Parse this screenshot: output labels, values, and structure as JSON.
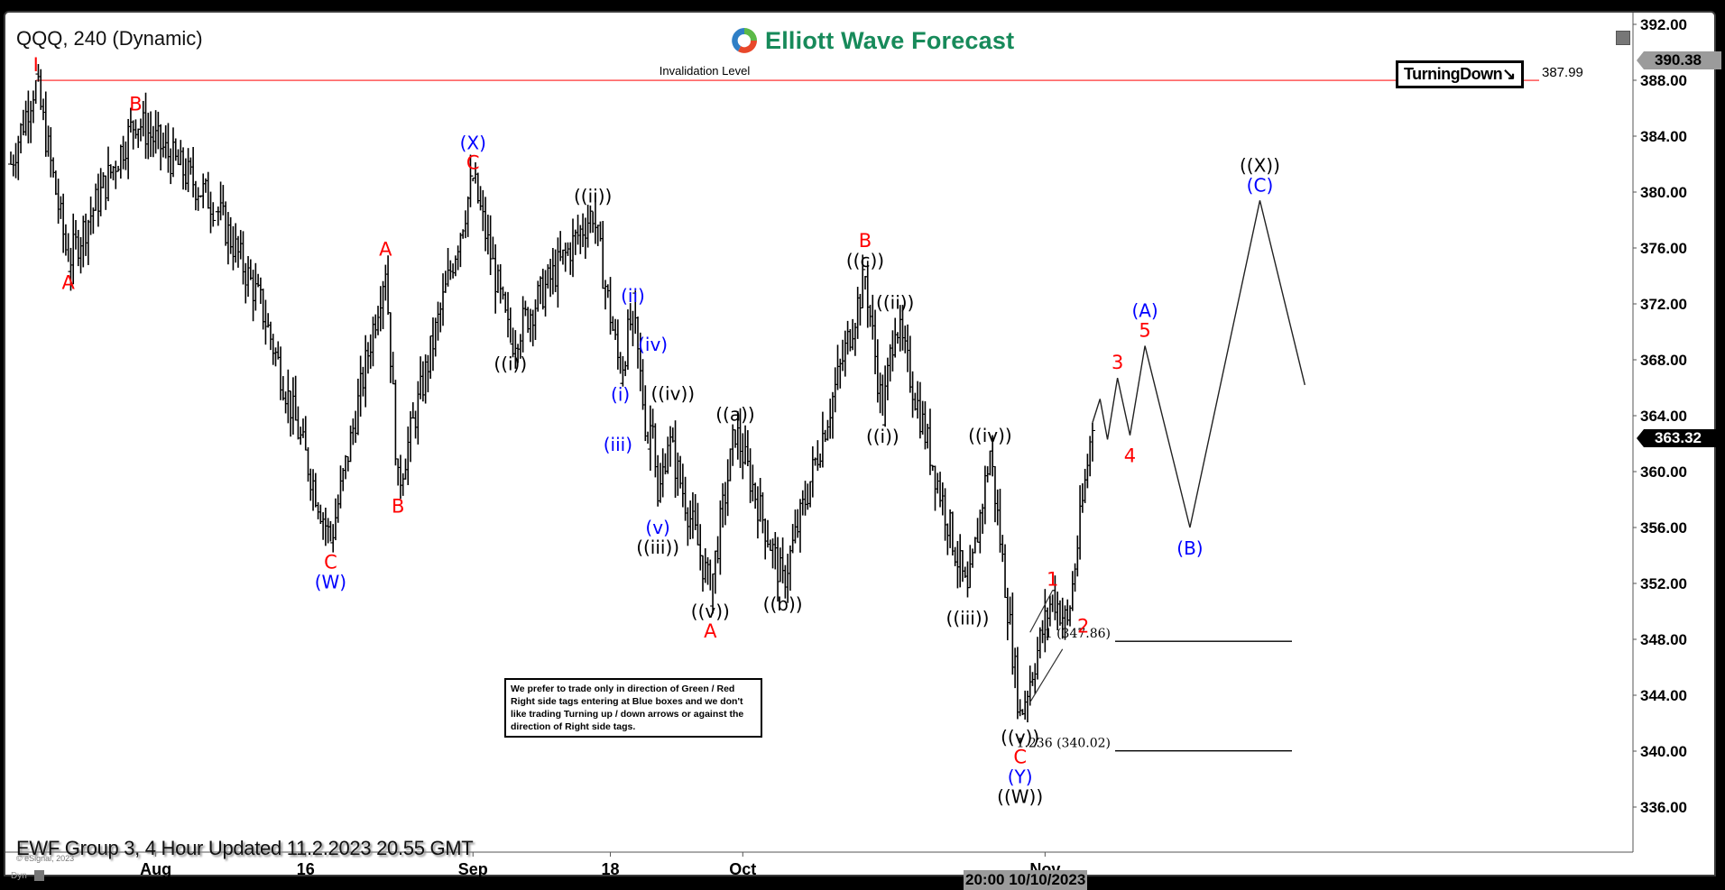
{
  "header": {
    "symbol_title": "QQQ, 240 (Dynamic)",
    "brand": "Elliott Wave Forecast",
    "turning_tag": "TurningDown",
    "turning_arrow": "↘"
  },
  "footer": {
    "update_text": "EWF Group 3, 4 Hour Updated 11.2.2023 20.55 GMT",
    "copyright": "© eSignal, 2023",
    "dyn_label": "Dyn",
    "crosshair_time": "20:00 10/10/2023"
  },
  "note": "We prefer to trade only in direction of Green / Red Right side tags entering at Blue boxes and we don't like trading Turning up / down arrows or against the direction of Right side tags.",
  "price_tags": {
    "high_tag": "390.38",
    "last_price": "363.32"
  },
  "colors": {
    "red": "#ff0000",
    "blue": "#0000ff",
    "black": "#000000",
    "brand_green": "#178a5a",
    "invalidation": "#ff5555"
  },
  "chart_data": {
    "type": "line",
    "title": "QQQ, 240 (Dynamic)",
    "xlabel": "",
    "ylabel": "",
    "ylim": [
      333,
      393
    ],
    "y_ticks": [
      336,
      340,
      344,
      348,
      352,
      356,
      360,
      364,
      368,
      372,
      376,
      380,
      384,
      388,
      392
    ],
    "x_ticks": [
      {
        "label": "Aug",
        "t": 58
      },
      {
        "label": "16",
        "t": 118
      },
      {
        "label": "Sep",
        "t": 185
      },
      {
        "label": "18",
        "t": 240
      },
      {
        "label": "Oct",
        "t": 293
      },
      {
        "label": "Nov",
        "t": 414
      }
    ],
    "x_range": [
      0,
      515
    ],
    "grid": false,
    "price_pivots": [
      {
        "t": 0,
        "p": 382.0
      },
      {
        "t": 10,
        "p": 388.0
      },
      {
        "t": 23,
        "p": 375.0
      },
      {
        "t": 50,
        "p": 385.2
      },
      {
        "t": 82,
        "p": 379.0
      },
      {
        "t": 100,
        "p": 372.0
      },
      {
        "t": 128,
        "p": 355.0
      },
      {
        "t": 150,
        "p": 374.8
      },
      {
        "t": 155,
        "p": 359.0
      },
      {
        "t": 185,
        "p": 381.0
      },
      {
        "t": 200,
        "p": 369.2
      },
      {
        "t": 233,
        "p": 378.6
      },
      {
        "t": 244,
        "p": 367.0
      },
      {
        "t": 249,
        "p": 371.5
      },
      {
        "t": 255,
        "p": 362.0
      },
      {
        "t": 257,
        "p": 364.5
      },
      {
        "t": 259,
        "p": 357.5
      },
      {
        "t": 263,
        "p": 362.5
      },
      {
        "t": 280,
        "p": 351.5
      },
      {
        "t": 290,
        "p": 363.0
      },
      {
        "t": 309,
        "p": 352.0
      },
      {
        "t": 342,
        "p": 374.0
      },
      {
        "t": 349,
        "p": 364.0
      },
      {
        "t": 354,
        "p": 371.0
      },
      {
        "t": 383,
        "p": 351.0
      },
      {
        "t": 392,
        "p": 361.5
      },
      {
        "t": 404,
        "p": 342.5
      },
      {
        "t": 417,
        "p": 351.2
      },
      {
        "t": 423,
        "p": 349.0
      },
      {
        "t": 433,
        "p": 363.5
      }
    ],
    "projection_path": [
      {
        "t": 433,
        "p": 363.5
      },
      {
        "t": 436,
        "p": 365.2
      },
      {
        "t": 439,
        "p": 362.3
      },
      {
        "t": 443,
        "p": 366.7
      },
      {
        "t": 448,
        "p": 362.6
      },
      {
        "t": 454,
        "p": 369.0
      },
      {
        "t": 472,
        "p": 356.0
      },
      {
        "t": 500,
        "p": 379.4
      },
      {
        "t": 518,
        "p": 366.2
      }
    ],
    "invalidation": {
      "label": "Invalidation Level",
      "price": 387.99,
      "price_label": "387.99"
    },
    "fib_levels": [
      {
        "label": "1 (347.86)",
        "price": 347.86
      },
      {
        "label": "1.236 (340.02)",
        "price": 340.02
      }
    ],
    "wave_labels": [
      {
        "text": "I",
        "t": 10,
        "p": 388.0,
        "pos": "above",
        "color": "red"
      },
      {
        "text": "A",
        "t": 23,
        "p": 375.0,
        "pos": "below",
        "color": "red"
      },
      {
        "text": "B",
        "t": 50,
        "p": 385.2,
        "pos": "above",
        "color": "red"
      },
      {
        "text": "C",
        "t": 128,
        "p": 355.0,
        "pos": "below",
        "color": "red"
      },
      {
        "text": "(W)",
        "t": 128,
        "p": 355.0,
        "pos": "below2",
        "color": "blue"
      },
      {
        "text": "A",
        "t": 150,
        "p": 374.8,
        "pos": "above",
        "color": "red"
      },
      {
        "text": "B",
        "t": 155,
        "p": 359.0,
        "pos": "below",
        "color": "red"
      },
      {
        "text": "C",
        "t": 185,
        "p": 381.0,
        "pos": "above",
        "color": "red"
      },
      {
        "text": "(X)",
        "t": 185,
        "p": 381.0,
        "pos": "above2",
        "color": "blue"
      },
      {
        "text": "((i))",
        "t": 200,
        "p": 369.2,
        "pos": "below",
        "color": "black"
      },
      {
        "text": "((ii))",
        "t": 233,
        "p": 378.6,
        "pos": "above",
        "color": "black"
      },
      {
        "text": "(i)",
        "t": 244,
        "p": 367.0,
        "pos": "below",
        "color": "blue"
      },
      {
        "text": "(ii)",
        "t": 249,
        "p": 371.5,
        "pos": "above",
        "color": "blue"
      },
      {
        "text": "(iii)",
        "t": 251,
        "p": 362.0,
        "pos": "left",
        "color": "blue"
      },
      {
        "text": "(iv)",
        "t": 257,
        "p": 368.0,
        "pos": "above",
        "color": "blue"
      },
      {
        "text": "(v)",
        "t": 259,
        "p": 357.5,
        "pos": "below",
        "color": "blue"
      },
      {
        "text": "((iii))",
        "t": 259,
        "p": 357.5,
        "pos": "below2",
        "color": "black"
      },
      {
        "text": "((iv))",
        "t": 265,
        "p": 364.5,
        "pos": "above",
        "color": "black"
      },
      {
        "text": "((v))",
        "t": 280,
        "p": 351.5,
        "pos": "below",
        "color": "black"
      },
      {
        "text": "A",
        "t": 280,
        "p": 351.5,
        "pos": "below2",
        "color": "red"
      },
      {
        "text": "((a))",
        "t": 290,
        "p": 363.0,
        "pos": "above",
        "color": "black"
      },
      {
        "text": "((b))",
        "t": 309,
        "p": 352.0,
        "pos": "below",
        "color": "black"
      },
      {
        "text": "((c))",
        "t": 342,
        "p": 374.0,
        "pos": "above",
        "color": "black"
      },
      {
        "text": "B",
        "t": 342,
        "p": 374.0,
        "pos": "above2",
        "color": "red"
      },
      {
        "text": "((i))",
        "t": 349,
        "p": 364.0,
        "pos": "below",
        "color": "black"
      },
      {
        "text": "((ii))",
        "t": 354,
        "p": 371.0,
        "pos": "above",
        "color": "black"
      },
      {
        "text": "((iii))",
        "t": 383,
        "p": 351.0,
        "pos": "below",
        "color": "black"
      },
      {
        "text": "((iv))",
        "t": 392,
        "p": 361.5,
        "pos": "above",
        "color": "black"
      },
      {
        "text": "((v))",
        "t": 404,
        "p": 342.5,
        "pos": "below",
        "color": "black"
      },
      {
        "text": "C",
        "t": 404,
        "p": 342.5,
        "pos": "below2",
        "color": "red"
      },
      {
        "text": "(Y)",
        "t": 404,
        "p": 342.5,
        "pos": "below3",
        "color": "blue"
      },
      {
        "text": "((W))",
        "t": 404,
        "p": 342.5,
        "pos": "below4",
        "color": "black"
      },
      {
        "text": "1",
        "t": 417,
        "p": 351.2,
        "pos": "above",
        "color": "red"
      },
      {
        "text": "2",
        "t": 424,
        "p": 349.0,
        "pos": "right",
        "color": "red"
      },
      {
        "text": "3",
        "t": 443,
        "p": 366.7,
        "pos": "above",
        "color": "red"
      },
      {
        "text": "4",
        "t": 448,
        "p": 362.6,
        "pos": "below",
        "color": "red"
      },
      {
        "text": "5",
        "t": 454,
        "p": 369.0,
        "pos": "above",
        "color": "red"
      },
      {
        "text": "(A)",
        "t": 454,
        "p": 369.0,
        "pos": "above2",
        "color": "blue"
      },
      {
        "text": "(B)",
        "t": 472,
        "p": 356.0,
        "pos": "below",
        "color": "blue"
      },
      {
        "text": "(C)",
        "t": 500,
        "p": 379.4,
        "pos": "above",
        "color": "blue"
      },
      {
        "text": "((X))",
        "t": 500,
        "p": 379.4,
        "pos": "above2",
        "color": "black"
      }
    ]
  }
}
